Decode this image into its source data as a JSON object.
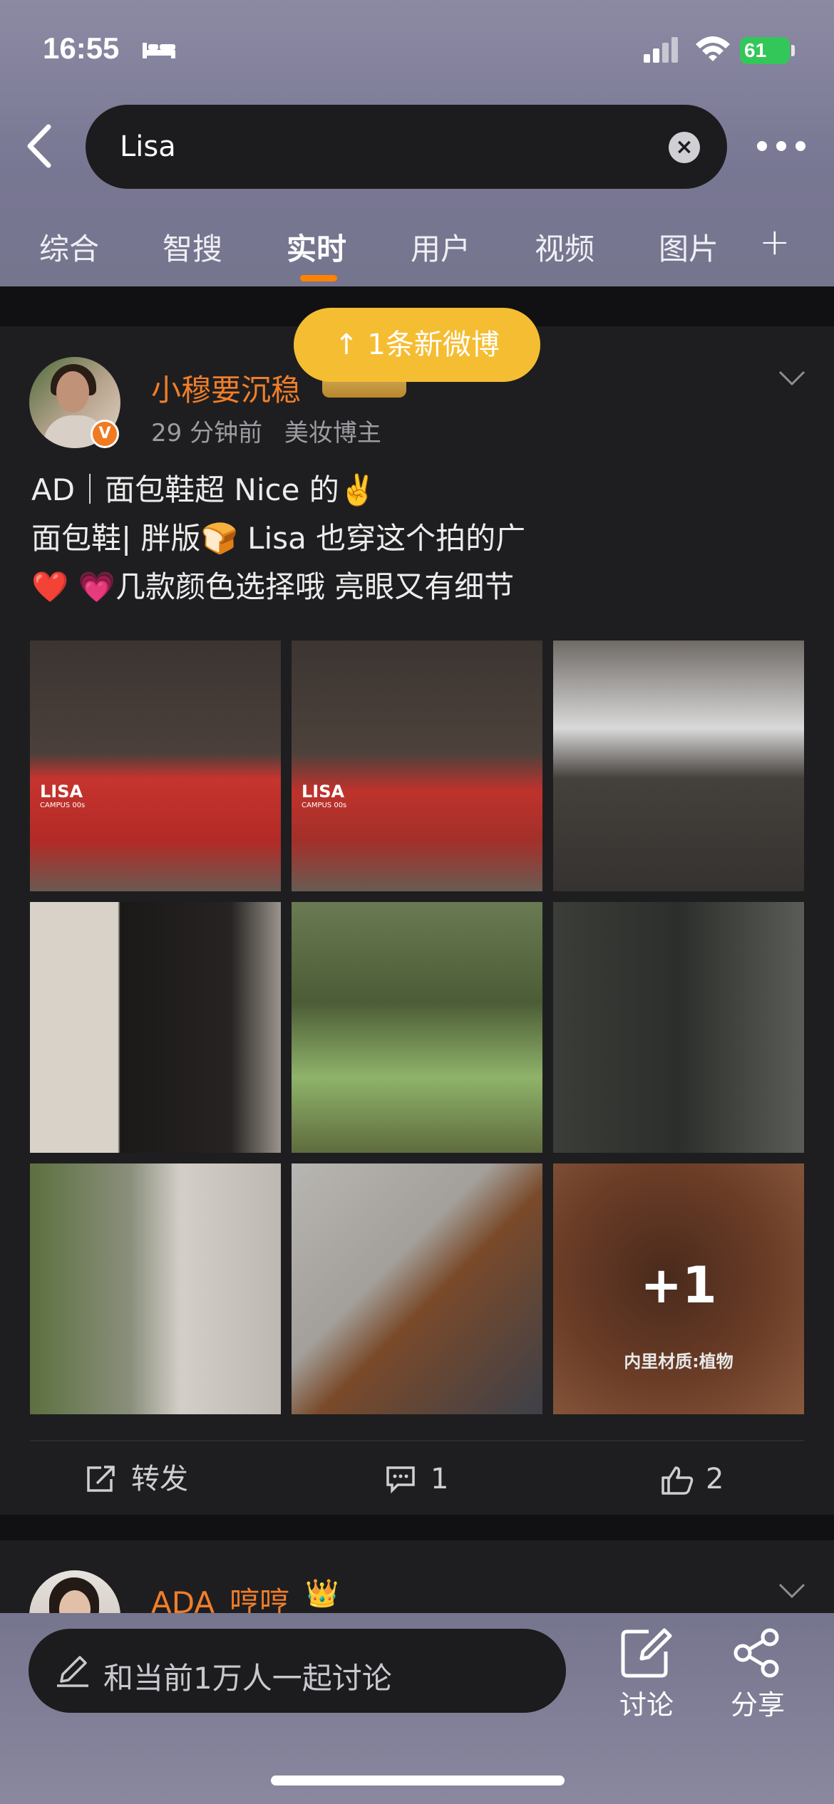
{
  "status_bar": {
    "time": "16:55",
    "battery": "61"
  },
  "search": {
    "query": "Lisa",
    "clear": "×"
  },
  "tabs": [
    {
      "label": "综合",
      "active": false
    },
    {
      "label": "智搜",
      "active": false
    },
    {
      "label": "实时",
      "active": true
    },
    {
      "label": "用户",
      "active": false
    },
    {
      "label": "视频",
      "active": false
    },
    {
      "label": "图片",
      "active": false
    }
  ],
  "tabs_add": "+",
  "new_posts_pill": "↑ 1条新微博",
  "post": {
    "username": "小穆要沉稳",
    "time_ago": "29 分钟前",
    "role": "美妆博主",
    "verified_mark": "V",
    "lines": [
      "AD｜面包鞋超 Nice 的✌️",
      "面包鞋| 胖版🍞 Lisa 也穿这个拍的广",
      "❤️ 💗几款颜色选择哦 亮眼又有细节"
    ],
    "image_brand": "LISA",
    "image_brand_sub": "CAMPUS 00s",
    "more_images": "+1",
    "more_images_caption": "内里材质:植物",
    "actions": {
      "repost": "转发",
      "comments": "1",
      "likes": "2"
    }
  },
  "next_post": {
    "username": "ADA_哼哼",
    "badge": "👑"
  },
  "bottom_bar": {
    "input_placeholder": "和当前1万人一起讨论",
    "discuss": "讨论",
    "share": "分享"
  },
  "colors": {
    "accent": "#ff8200",
    "username": "#f07e2a",
    "pill": "#f5bd32"
  }
}
